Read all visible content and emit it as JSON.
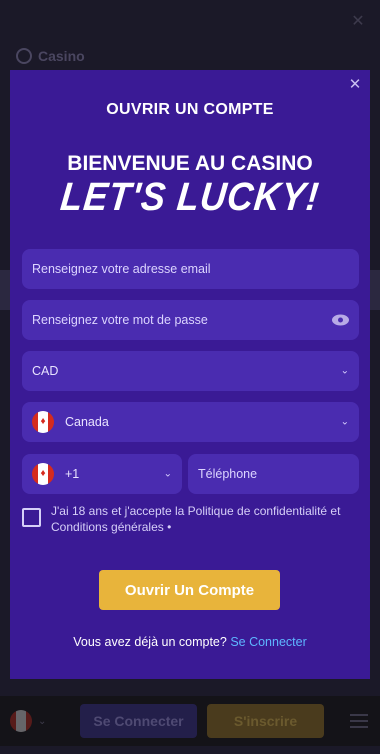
{
  "background": {
    "section_label": "Casino"
  },
  "bottom_bar": {
    "login_label": "Se Connecter",
    "signup_label": "S'inscrire"
  },
  "modal": {
    "title": "OUVRIR UN COMPTE",
    "welcome": "BIENVENUE AU CASINO",
    "brand": "LET'S LUCKY!",
    "email": {
      "placeholder": "Renseignez votre adresse email",
      "value": ""
    },
    "password": {
      "placeholder": "Renseignez votre mot de passe",
      "value": ""
    },
    "currency": {
      "selected": "CAD"
    },
    "country": {
      "selected": "Canada",
      "flag": "canada-flag"
    },
    "phone_prefix": {
      "selected": "+1",
      "flag": "canada-flag"
    },
    "phone": {
      "placeholder": "Téléphone",
      "value": ""
    },
    "terms_text": "J'ai 18 ans et j'accepte la Politique de confidentialité et Conditions générales •",
    "terms_checked": false,
    "submit_label": "Ouvrir Un Compte",
    "footer_text": "Vous avez déjà un compte?",
    "footer_link": "Se Connecter"
  },
  "colors": {
    "modal_bg": "#3a1a95",
    "field_bg": "#4a2cb0",
    "cta": "#e8b43b",
    "link": "#5eb6ff"
  }
}
